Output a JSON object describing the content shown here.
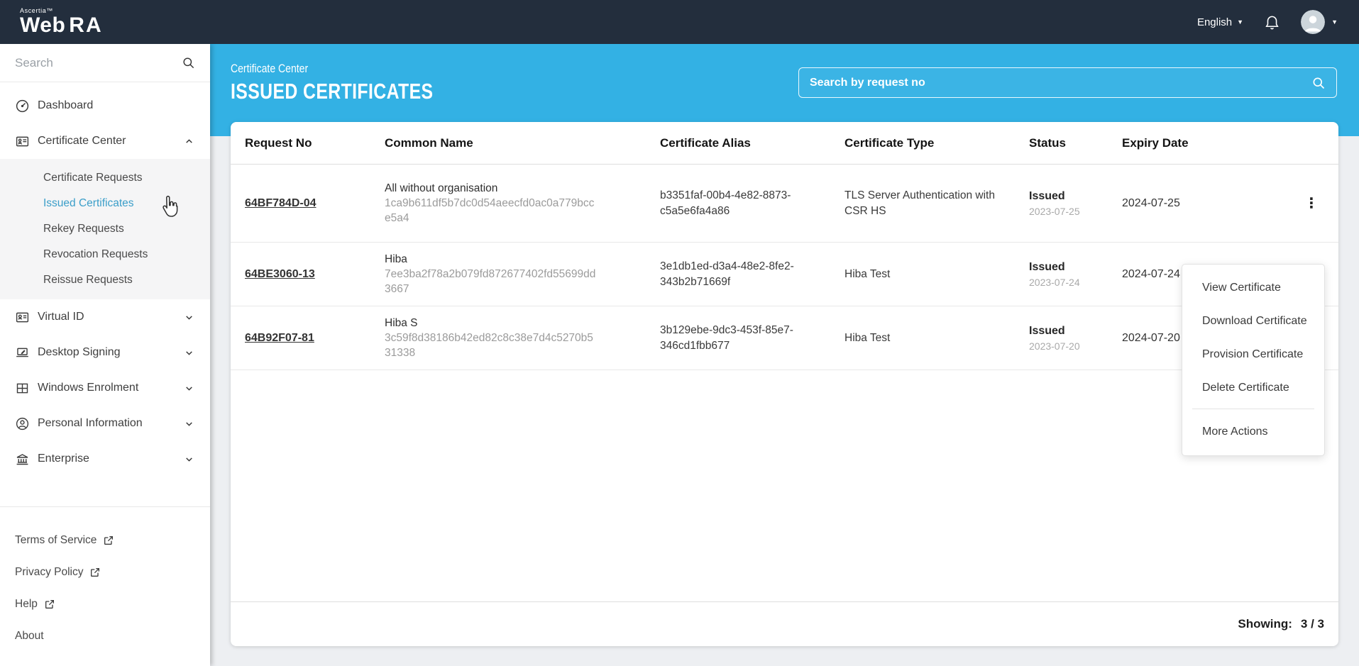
{
  "topbar": {
    "brand_small": "Ascertia™",
    "brand_web": "Web",
    "brand_ra": "RA",
    "language": "English"
  },
  "glyphs": {
    "caret_down": "▼",
    "kebab": "⋮"
  },
  "sidebar": {
    "search_placeholder": "Search",
    "items": [
      "Dashboard",
      "Certificate Center",
      "Virtual ID",
      "Desktop Signing",
      "Windows Enrolment",
      "Personal Information",
      "Enterprise"
    ],
    "submenu": [
      "Certificate Requests",
      "Issued Certificates",
      "Rekey Requests",
      "Revocation Requests",
      "Reissue Requests"
    ],
    "active_item": "Issued Certificates",
    "links": [
      "Terms of Service",
      "Privacy Policy",
      "Help",
      "About"
    ]
  },
  "band": {
    "breadcrumb": "Certificate Center",
    "title": "ISSUED CERTIFICATES",
    "search_placeholder": "Search by request no"
  },
  "table": {
    "columns": [
      "Request No",
      "Common Name",
      "Certificate Alias",
      "Certificate Type",
      "Status",
      "Expiry Date"
    ],
    "rows": [
      {
        "request_no": "64BF784D-04",
        "common_name": "All without organisation",
        "fingerprint": "1ca9b611df5b7dc0d54aeecfd0ac0a779bcce5a4",
        "alias": "b3351faf-00b4-4e82-8873-c5a5e6fa4a86",
        "type": "TLS Server Authentication with CSR HS",
        "status": "Issued",
        "status_date": "2023-07-25",
        "expiry": "2024-07-25"
      },
      {
        "request_no": "64BE3060-13",
        "common_name": "Hiba",
        "fingerprint": "7ee3ba2f78a2b079fd872677402fd55699dd3667",
        "alias": "3e1db1ed-d3a4-48e2-8fe2-343b2b71669f",
        "type": "Hiba Test",
        "status": "Issued",
        "status_date": "2023-07-24",
        "expiry": "2024-07-24"
      },
      {
        "request_no": "64B92F07-81",
        "common_name": "Hiba S",
        "fingerprint": "3c59f8d38186b42ed82c8c38e7d4c5270b531338",
        "alias": "3b129ebe-9dc3-453f-85e7-346cd1fbb677",
        "type": "Hiba Test",
        "status": "Issued",
        "status_date": "2023-07-20",
        "expiry": "2024-07-20"
      }
    ]
  },
  "menu": {
    "items": [
      "View Certificate",
      "Download Certificate",
      "Provision Certificate",
      "Delete Certificate"
    ],
    "more": "More Actions"
  },
  "summary": {
    "label": "Showing:",
    "value": "3 / 3"
  },
  "colors": {
    "topbar_bg": "#232e3d",
    "accent_blue": "#33b1e4",
    "active_link": "#3b9ec9",
    "text_dark": "#333333",
    "muted_gray": "#9b9b9b"
  }
}
